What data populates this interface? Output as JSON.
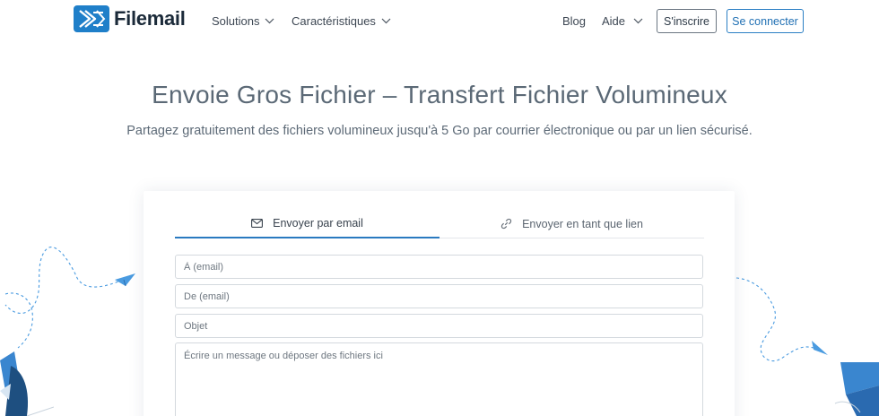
{
  "brand": {
    "name": "Filemail",
    "color": "#1f7fc9"
  },
  "nav": {
    "solutions": "Solutions",
    "caracteristiques": "Caractéristiques",
    "blog": "Blog",
    "aide": "Aide",
    "signup": "S'inscrire",
    "login": "Se connecter"
  },
  "hero": {
    "title": "Envoie Gros Fichier – Transfert Fichier Volumineux",
    "subtitle": "Partagez gratuitement des fichiers volumineux jusqu'à 5 Go par courrier électronique ou par un lien sécurisé."
  },
  "form": {
    "tabs": [
      {
        "label": "Envoyer par email",
        "icon": "envelope-icon",
        "active": true
      },
      {
        "label": "Envoyer en tant que lien",
        "icon": "link-icon",
        "active": false
      }
    ],
    "to_placeholder": "À (email)",
    "from_placeholder": "De (email)",
    "subject_placeholder": "Objet",
    "message_placeholder": "Écrire un message ou déposer des fichiers ici"
  },
  "colors": {
    "accent": "#2a7ac0",
    "decor": "#4a9be0",
    "decor_dark": "#1e4f80"
  }
}
